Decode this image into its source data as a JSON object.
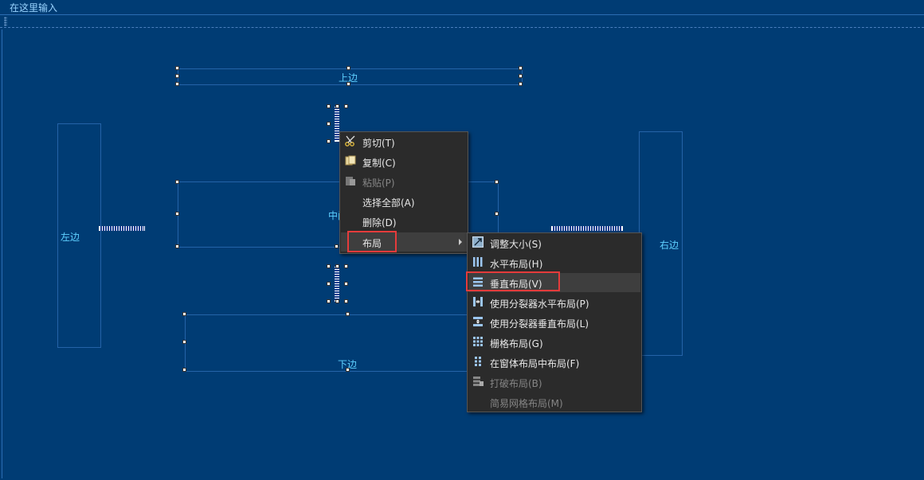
{
  "menubar": {
    "hint": "在这里输入"
  },
  "widgets": {
    "top": "上边",
    "left": "左边",
    "center": "中间",
    "right": "右边",
    "bottom": "下边"
  },
  "context_menu": {
    "items": [
      {
        "label": "剪切(T)",
        "icon": "scissors-icon",
        "enabled": true
      },
      {
        "label": "复制(C)",
        "icon": "copy-icon",
        "enabled": true
      },
      {
        "label": "粘贴(P)",
        "icon": "paste-icon",
        "enabled": false
      },
      {
        "label": "选择全部(A)",
        "icon": "",
        "enabled": true
      },
      {
        "label": "删除(D)",
        "icon": "",
        "enabled": true
      },
      {
        "label": "布局",
        "icon": "",
        "enabled": true,
        "submenu": true
      }
    ]
  },
  "layout_submenu": {
    "items": [
      {
        "label": "调整大小(S)",
        "icon": "resize-icon",
        "enabled": true
      },
      {
        "label": "水平布局(H)",
        "icon": "horizontal-layout-icon",
        "enabled": true
      },
      {
        "label": "垂直布局(V)",
        "icon": "vertical-layout-icon",
        "enabled": true
      },
      {
        "label": "使用分裂器水平布局(P)",
        "icon": "splitter-horizontal-icon",
        "enabled": true
      },
      {
        "label": "使用分裂器垂直布局(L)",
        "icon": "splitter-vertical-icon",
        "enabled": true
      },
      {
        "label": "栅格布局(G)",
        "icon": "grid-layout-icon",
        "enabled": true
      },
      {
        "label": "在窗体布局中布局(F)",
        "icon": "form-layout-icon",
        "enabled": true
      },
      {
        "label": "打破布局(B)",
        "icon": "break-layout-icon",
        "enabled": false
      },
      {
        "label": "简易网格布局(M)",
        "icon": "",
        "enabled": false
      }
    ]
  },
  "colors": {
    "canvas": "#003c74",
    "label": "#5fd0ff",
    "menu_bg": "#2b2b2b",
    "highlight_box": "#e53b3b"
  }
}
